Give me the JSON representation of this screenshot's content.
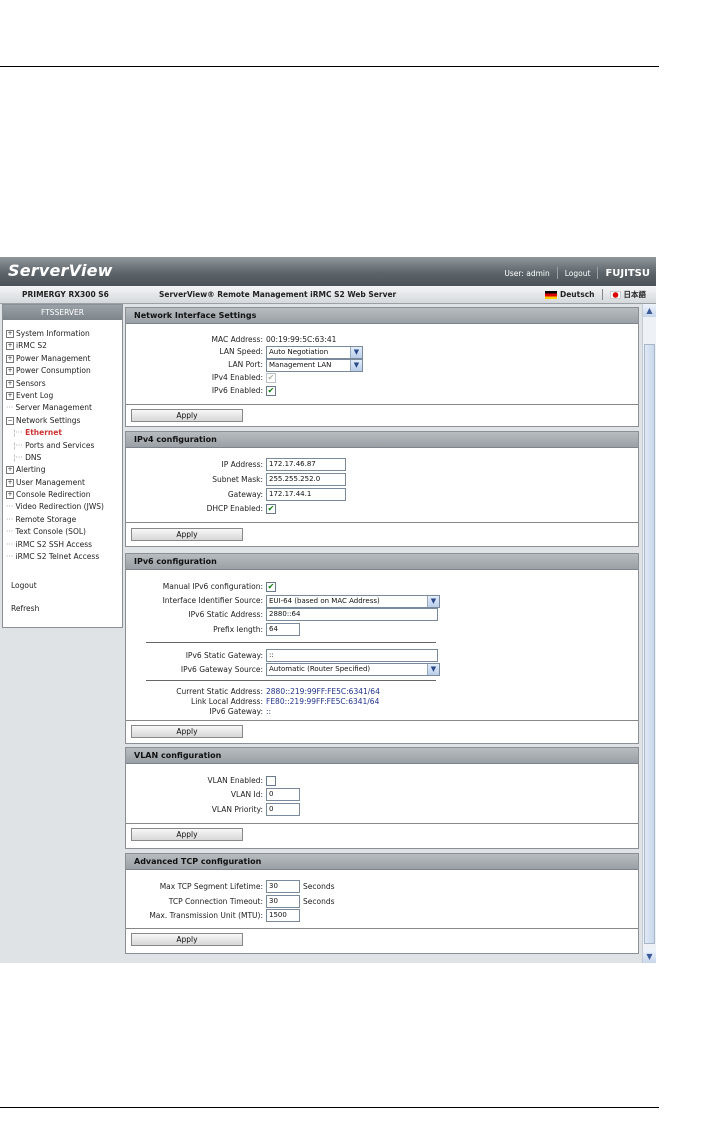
{
  "header": {
    "logo": "ServerView",
    "user": "User: admin",
    "logout": "Logout",
    "brand": "FUJITSU"
  },
  "subbar": {
    "server": "PRIMERGY RX300 S6",
    "title": "ServerView® Remote Management iRMC S2 Web Server",
    "lang_de": "Deutsch",
    "lang_jp": "日本語"
  },
  "sidebar": {
    "head": "FTSSERVER",
    "items": [
      {
        "label": "System Information",
        "icon": "plus"
      },
      {
        "label": "iRMC S2",
        "icon": "plus"
      },
      {
        "label": "Power Management",
        "icon": "plus"
      },
      {
        "label": "Power Consumption",
        "icon": "plus"
      },
      {
        "label": "Sensors",
        "icon": "plus"
      },
      {
        "label": "Event Log",
        "icon": "plus"
      },
      {
        "label": "Server Management",
        "icon": "dash"
      },
      {
        "label": "Network Settings",
        "icon": "minus"
      },
      {
        "label": "Ethernet",
        "icon": "sub-active"
      },
      {
        "label": "Ports and Services",
        "icon": "sub"
      },
      {
        "label": "DNS",
        "icon": "sub"
      },
      {
        "label": "Alerting",
        "icon": "plus"
      },
      {
        "label": "User Management",
        "icon": "plus"
      },
      {
        "label": "Console Redirection",
        "icon": "plus"
      },
      {
        "label": "Video Redirection (JWS)",
        "icon": "dash"
      },
      {
        "label": "Remote Storage",
        "icon": "dash"
      },
      {
        "label": "Text Console (SOL)",
        "icon": "dash"
      },
      {
        "label": "iRMC S2 SSH Access",
        "icon": "dash"
      },
      {
        "label": "iRMC S2 Telnet Access",
        "icon": "dash"
      }
    ],
    "logout": "Logout",
    "refresh": "Refresh"
  },
  "network_interface": {
    "title": "Network Interface Settings",
    "mac_label": "MAC Address:",
    "mac_value": "00:19:99:5C:63:41",
    "lan_speed_label": "LAN Speed:",
    "lan_speed_value": "Auto Negotiation",
    "lan_port_label": "LAN Port:",
    "lan_port_value": "Management LAN",
    "ipv4_label": "IPv4 Enabled:",
    "ipv6_label": "IPv6 Enabled:",
    "apply": "Apply"
  },
  "ipv4": {
    "title": "IPv4 configuration",
    "ip_label": "IP Address:",
    "ip_value": "172.17.46.87",
    "mask_label": "Subnet Mask:",
    "mask_value": "255.255.252.0",
    "gw_label": "Gateway:",
    "gw_value": "172.17.44.1",
    "dhcp_label": "DHCP Enabled:",
    "apply": "Apply"
  },
  "ipv6": {
    "title": "IPv6 configuration",
    "manual_label": "Manual IPv6 configuration:",
    "iid_label": "Interface Identifier Source:",
    "iid_value": "EUI-64 (based on MAC Address)",
    "static_label": "IPv6 Static Address:",
    "static_value": "2880::64",
    "prefix_label": "Prefix length:",
    "prefix_value": "64",
    "sgw_label": "IPv6 Static Gateway:",
    "sgw_value": "::",
    "gws_label": "IPv6 Gateway Source:",
    "gws_value": "Automatic (Router Specified)",
    "cur_label": "Current Static Address:",
    "cur_value": "2880::219:99FF:FE5C:6341/64",
    "link_label": "Link Local Address:",
    "link_value": "FE80::219:99FF:FE5C:6341/64",
    "gw_label": "IPv6 Gateway:",
    "gw_value": "::",
    "apply": "Apply"
  },
  "vlan": {
    "title": "VLAN configuration",
    "enabled_label": "VLAN Enabled:",
    "id_label": "VLAN Id:",
    "id_value": "0",
    "prio_label": "VLAN Priority:",
    "prio_value": "0",
    "apply": "Apply"
  },
  "tcp": {
    "title": "Advanced TCP configuration",
    "seg_label": "Max TCP Segment Lifetime:",
    "seg_value": "30",
    "seg_unit": "Seconds",
    "conn_label": "TCP Connection Timeout:",
    "conn_value": "30",
    "conn_unit": "Seconds",
    "mtu_label": "Max. Transmission Unit (MTU):",
    "mtu_value": "1500",
    "apply": "Apply"
  },
  "checkmark": "✔",
  "arrow_down": "▼",
  "arrow_up": "▲"
}
